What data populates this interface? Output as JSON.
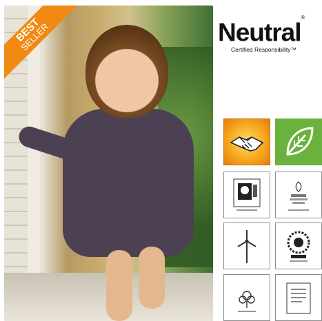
{
  "badge": {
    "line1": "BEST",
    "line2": "SELLER"
  },
  "brand": {
    "name": "Neutral",
    "trademark": "®",
    "tagline": "Certified Responsibility™"
  },
  "colors": {
    "badge": "#f08a12",
    "brand_text": "#111111",
    "orange_tile": "#f4a41a",
    "green_tile": "#6ab23d"
  },
  "tiles": [
    {
      "icon": "handshake-icon"
    },
    {
      "icon": "leaf-icon"
    },
    {
      "icon": "fairtrade-certificate-icon"
    },
    {
      "icon": "organic-certificate-icon"
    },
    {
      "icon": "wind-turbine-icon"
    },
    {
      "icon": "sun-emblem-icon"
    },
    {
      "icon": "cotton-plant-icon"
    },
    {
      "icon": "document-icon"
    }
  ]
}
